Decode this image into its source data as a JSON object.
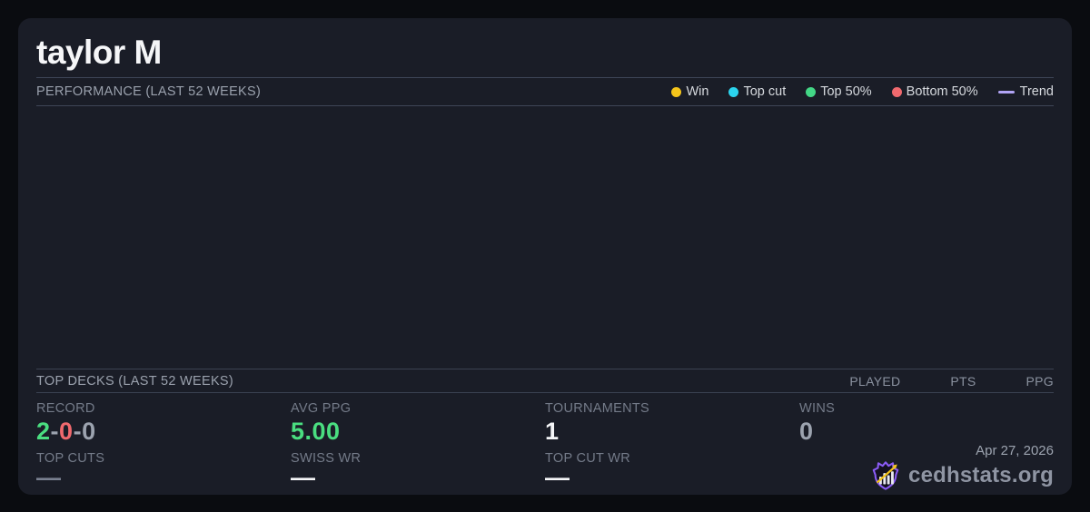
{
  "colors": {
    "background": "#0a0c10",
    "card": "#1a1d27",
    "divider": "#3e4557",
    "green": "#4ade80",
    "red": "#f0696e",
    "gray": "#9ca3af",
    "dimgray": "#7a8191",
    "white": "#f5f6f8",
    "logo_purple": "#8b5cf6",
    "logo_yellow": "#f5c51b",
    "logo_bar": "#e9eaf0",
    "logo_fill": "#141220"
  },
  "header": {
    "title": "taylor M"
  },
  "performance": {
    "label": "PERFORMANCE (LAST 52 WEEKS)",
    "legend": [
      {
        "id": "win",
        "label": "Win",
        "type": "dot",
        "color": "#f5c51b"
      },
      {
        "id": "top-cut",
        "label": "Top cut",
        "type": "dot",
        "color": "#2bd4ee"
      },
      {
        "id": "top-50",
        "label": "Top 50%",
        "type": "dot",
        "color": "#43d786"
      },
      {
        "id": "bottom-50",
        "label": "Bottom 50%",
        "type": "dot",
        "color": "#f0696e"
      },
      {
        "id": "trend",
        "label": "Trend",
        "type": "line",
        "color": "#b1a4f5"
      }
    ]
  },
  "top_decks": {
    "label": "TOP DECKS (LAST 52 WEEKS)",
    "columns": [
      "PLAYED",
      "PTS",
      "PPG"
    ],
    "rows": []
  },
  "stats": {
    "columns": [
      {
        "id": "record",
        "top_label": "RECORD",
        "top_parts": [
          [
            "2",
            "green"
          ],
          [
            "-",
            "gray"
          ],
          [
            "0",
            "red"
          ],
          [
            "-",
            "gray"
          ],
          [
            "0",
            "gray"
          ]
        ],
        "bottom_label": "TOP CUTS",
        "bottom_parts": [
          [
            "—",
            "dimgray"
          ]
        ]
      },
      {
        "id": "avg-ppg",
        "top_label": "AVG PPG",
        "top_parts": [
          [
            "5.00",
            "green"
          ]
        ],
        "bottom_label": "SWISS WR",
        "bottom_parts": [
          [
            "—",
            "white"
          ]
        ]
      },
      {
        "id": "tournaments",
        "top_label": "TOURNAMENTS",
        "top_parts": [
          [
            "1",
            "white"
          ]
        ],
        "bottom_label": "TOP CUT WR",
        "bottom_parts": [
          [
            "—",
            "white"
          ]
        ]
      },
      {
        "id": "wins",
        "top_label": "WINS",
        "top_parts": [
          [
            "0",
            "gray"
          ]
        ]
      }
    ]
  },
  "footer": {
    "date": "Apr 27, 2026",
    "brand": "cedhstats.org"
  }
}
